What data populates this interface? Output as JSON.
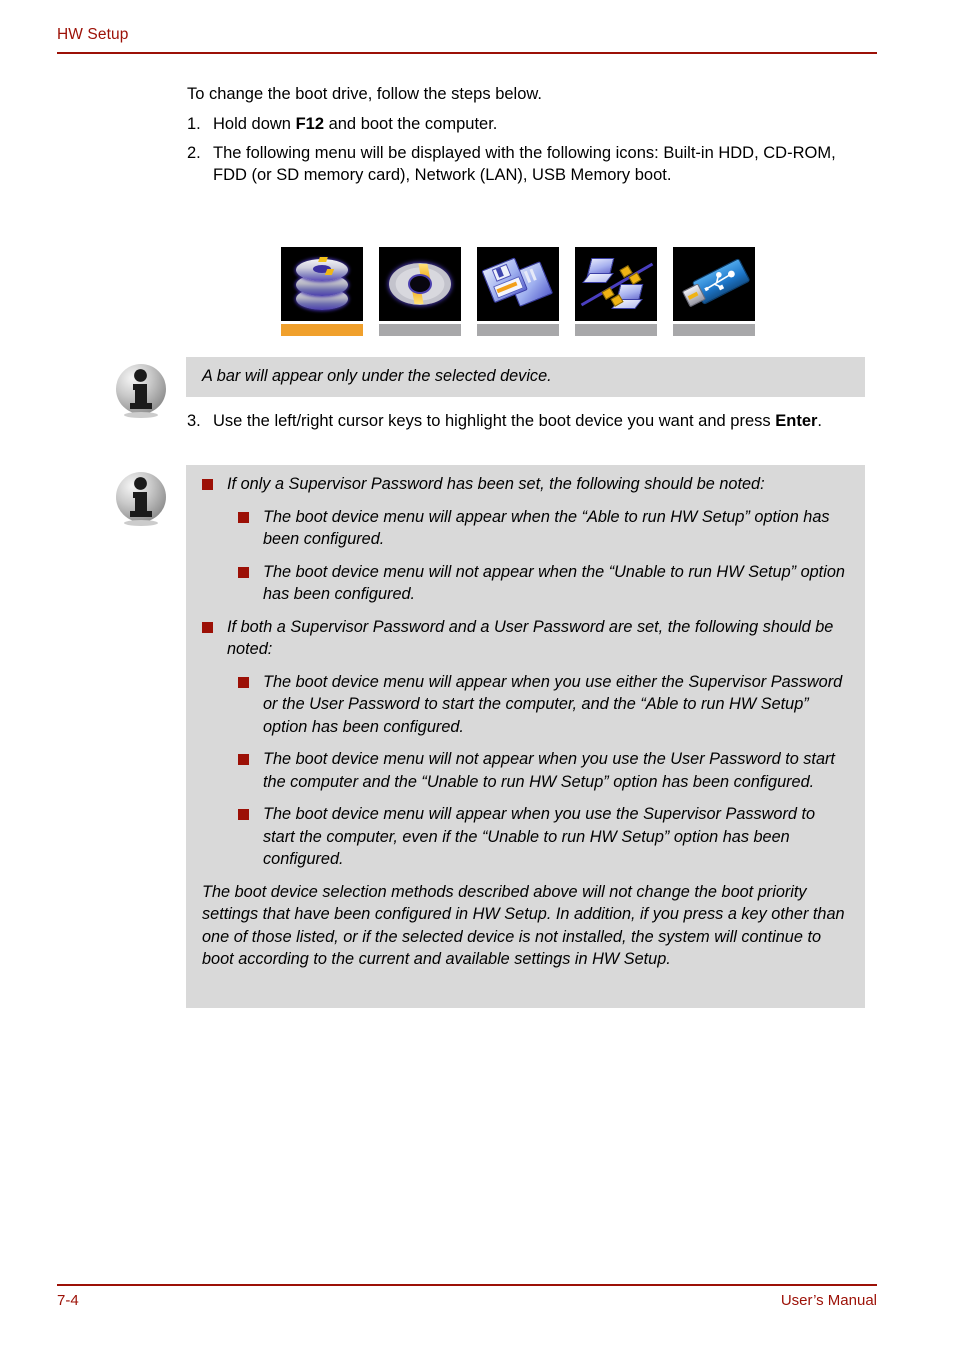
{
  "header": {
    "title": "HW Setup"
  },
  "main": {
    "intro": "To change the boot drive, follow the steps below.",
    "steps": [
      {
        "number": "1.",
        "text_before": "Hold down ",
        "bold": "F12",
        "text_after": " and boot the computer."
      },
      {
        "number": "2.",
        "text": "The following menu will be displayed with the following icons: Built-in HDD, CD-ROM, FDD (or SD memory card), Network (LAN), USB Memory boot."
      }
    ],
    "step3": {
      "number": "3.",
      "text_before": "Use the left/right cursor keys to highlight the boot device you want and press ",
      "bold": "Enter",
      "text_after": "."
    }
  },
  "boot_icons": [
    {
      "name": "Built-in HDD",
      "icon": "hdd-icon",
      "selected": true
    },
    {
      "name": "CD-ROM",
      "icon": "cdrom-icon",
      "selected": false
    },
    {
      "name": "FDD",
      "icon": "fdd-icon",
      "selected": false
    },
    {
      "name": "Network (LAN)",
      "icon": "network-icon",
      "selected": false
    },
    {
      "name": "USB Memory",
      "icon": "usb-icon",
      "selected": false
    }
  ],
  "note1": {
    "icon": "info-icon",
    "text": "A bar will appear only under the selected device."
  },
  "note2": {
    "icon": "info-icon",
    "bullets": [
      {
        "level": 1,
        "text": "If only a Supervisor Password has been set, the following should be noted:"
      },
      {
        "level": 2,
        "text": "The boot device menu will appear when the “Able to run HW Setup” option has been configured."
      },
      {
        "level": 2,
        "text": "The boot device menu will not appear when the “Unable to run HW Setup” option has been configured."
      },
      {
        "level": 1,
        "text": "If both a Supervisor Password and a User Password are set, the following should be noted:"
      },
      {
        "level": 2,
        "text": "The boot device menu will appear when you use either the Supervisor Password or the User Password to start the computer, and the “Able to run HW Setup” option has been configured."
      },
      {
        "level": 2,
        "text": "The boot device menu will not appear when you use the User Password to start the computer and the “Unable to run HW Setup” option has been configured."
      },
      {
        "level": 2,
        "text": "The boot device menu will appear when you use the Supervisor Password to start the computer, even if the “Unable to run HW Setup” option has been configured."
      }
    ],
    "closing_paragraph": "The boot device selection methods described above will not change the boot priority settings that have been configured in HW Setup. In addition, if you press a key other than one of those listed, or if the selected device is not installed, the system will continue to boot according to the current and available settings in HW Setup."
  },
  "footer": {
    "page_number": "7-4",
    "manual_label": "User’s Manual"
  },
  "colors": {
    "accent_red": "#9c1006",
    "note_background": "#d9d9d9",
    "selected_bar": "#f0a02c",
    "unselected_bar": "#a8a8aa"
  }
}
